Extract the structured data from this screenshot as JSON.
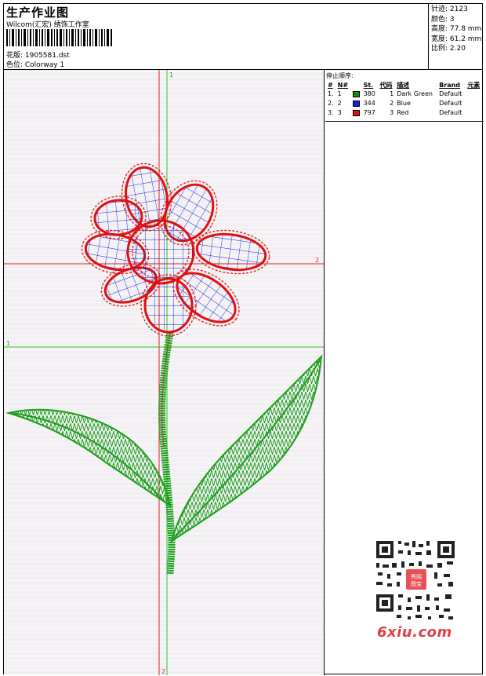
{
  "header": {
    "title": "生产作业图",
    "subtitle": "Wilcom(汇宏) 绣饰工作室",
    "design_label": "花版: 1905581.dst",
    "colorway_label": "色位: Colorway 1"
  },
  "stats": [
    {
      "label": "针迹: 2123"
    },
    {
      "label": "颜色: 3"
    },
    {
      "label": "高度: 77.8 mm"
    },
    {
      "label": "宽度: 61.2 mm"
    },
    {
      "label": "比例: 2.20"
    }
  ],
  "stop_panel": {
    "title": "停止顺序:",
    "headers": [
      "#",
      "N#",
      "St.",
      "代码",
      "描述",
      "Brand",
      "元素"
    ],
    "rows": [
      {
        "num": "1.",
        "n": "1",
        "color": "#109010",
        "st": "380",
        "code": "1",
        "desc": "Dark Green",
        "brand": "Default"
      },
      {
        "num": "2.",
        "n": "2",
        "color": "#1020e0",
        "st": "344",
        "code": "2",
        "desc": "Blue",
        "brand": "Default"
      },
      {
        "num": "3.",
        "n": "3",
        "color": "#e01010",
        "st": "797",
        "code": "3",
        "desc": "Red",
        "brand": "Default"
      }
    ]
  },
  "canvas": {
    "guide_labels": {
      "green_top": "1",
      "green_left": "1",
      "red_right": "2",
      "red_bottom": "2"
    },
    "colors": {
      "green": "#1a9e1a",
      "blue": "#1020d0",
      "red": "#e01010",
      "guide_green": "#22cc22",
      "guide_red": "#e02020"
    }
  },
  "watermark": {
    "text": "6xiu.com",
    "badge": "秀网图宝"
  }
}
